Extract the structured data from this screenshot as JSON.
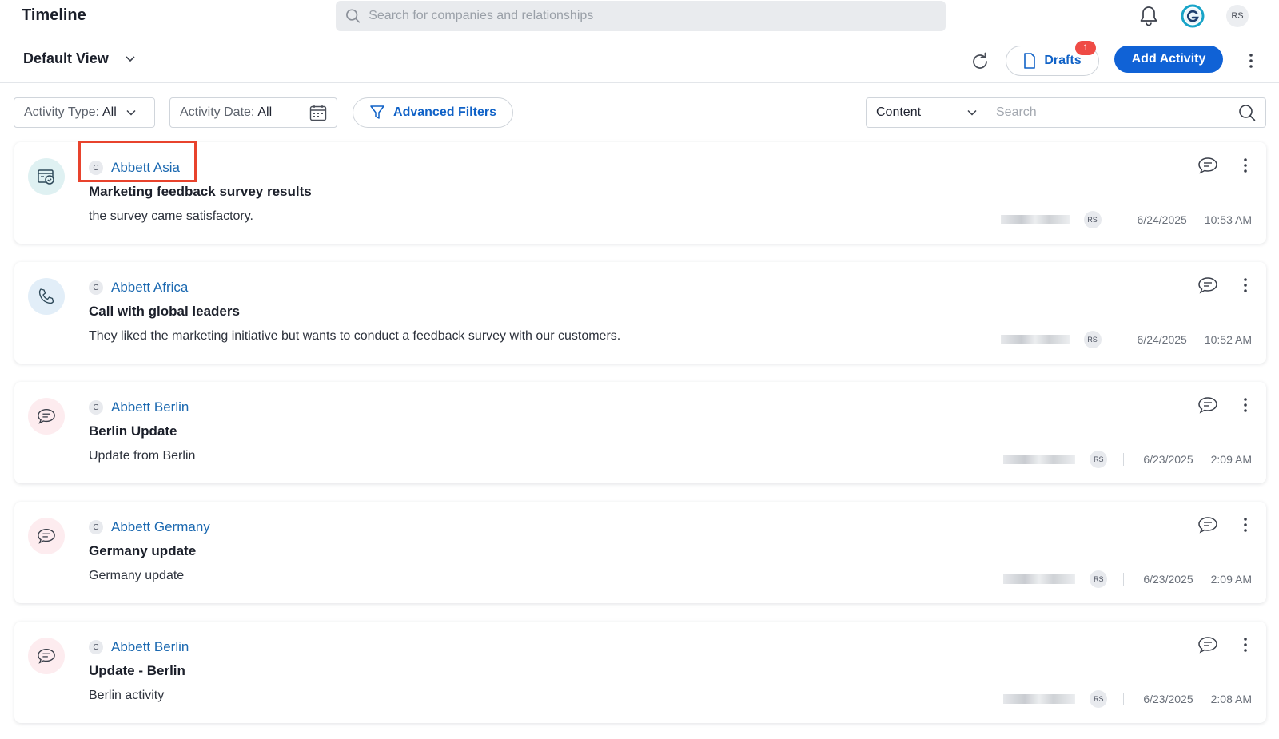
{
  "header": {
    "title": "Timeline",
    "search_placeholder": "Search for companies and relationships",
    "user_initials": "RS"
  },
  "toolbar": {
    "view_label": "Default View",
    "drafts_label": "Drafts",
    "drafts_count": "1",
    "add_activity_label": "Add Activity"
  },
  "filters": {
    "activity_type_label": "Activity Type:",
    "activity_type_value": "All",
    "activity_date_label": "Activity Date:",
    "activity_date_value": "All",
    "advanced_label": "Advanced Filters",
    "content_value": "Content",
    "search_placeholder": "Search"
  },
  "activities": [
    {
      "type": "meeting-icon",
      "company_badge": "C",
      "company": "Abbett Asia",
      "title": "Marketing feedback survey results",
      "description": "the survey came satisfactory.",
      "user": "RS",
      "date": "6/24/2025",
      "time": "10:53 AM"
    },
    {
      "type": "phone-icon",
      "company_badge": "C",
      "company": "Abbett Africa",
      "title": "Call with global leaders",
      "description": "They liked the marketing initiative but wants to conduct a feedback survey with our customers.",
      "user": "RS",
      "date": "6/24/2025",
      "time": "10:52 AM"
    },
    {
      "type": "chat-icon",
      "company_badge": "C",
      "company": "Abbett Berlin",
      "title": "Berlin Update",
      "description": "Update from Berlin",
      "user": "RS",
      "date": "6/23/2025",
      "time": "2:09 AM"
    },
    {
      "type": "chat-icon",
      "company_badge": "C",
      "company": "Abbett Germany",
      "title": "Germany update",
      "description": "Germany update",
      "user": "RS",
      "date": "6/23/2025",
      "time": "2:09 AM"
    },
    {
      "type": "chat-icon",
      "company_badge": "C",
      "company": "Abbett Berlin",
      "title": "Update - Berlin",
      "description": "Berlin activity",
      "user": "RS",
      "date": "6/23/2025",
      "time": "2:08 AM"
    }
  ],
  "colors": {
    "primary": "#1062d6",
    "link": "#1a68b0",
    "badge": "#ef4b45",
    "highlight": "#e8432d"
  }
}
